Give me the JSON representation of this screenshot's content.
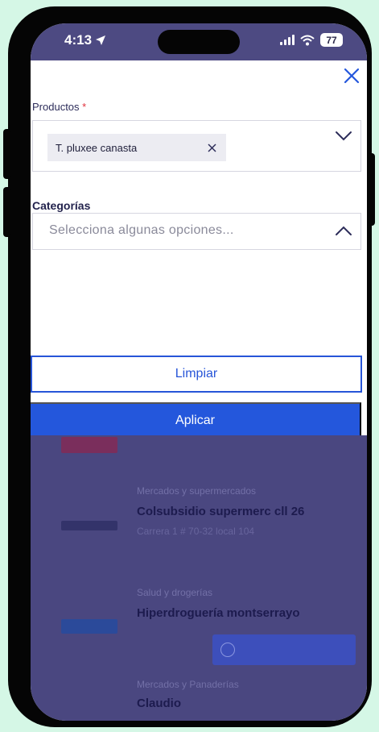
{
  "status_bar": {
    "time": "4:13",
    "battery": "77"
  },
  "filter_sheet": {
    "products": {
      "label": "Productos",
      "required_mark": "*",
      "selected_chip": "T. pluxee canasta"
    },
    "categories": {
      "label": "Categorías",
      "placeholder": "Selecciona algunas opciones..."
    },
    "buttons": {
      "clear": "Limpiar",
      "apply": "Aplicar"
    }
  },
  "background_list": {
    "items": [
      {
        "category": "",
        "name": "",
        "sub": ""
      },
      {
        "category": "Mercados y supermercados",
        "name": "Colsubsidio supermerc cll 26",
        "sub": "Carrera 1 # 70-32 local 104"
      },
      {
        "category": "Salud y drogerías",
        "name": "Hiperdroguería montserrayo",
        "sub": ""
      },
      {
        "category": "Mercados y Panaderías",
        "name": "Claudio",
        "sub": ""
      }
    ]
  },
  "colors": {
    "accent": "#2457dc",
    "overlay": "#4a4780",
    "page_bg": "#d5f7e6"
  }
}
